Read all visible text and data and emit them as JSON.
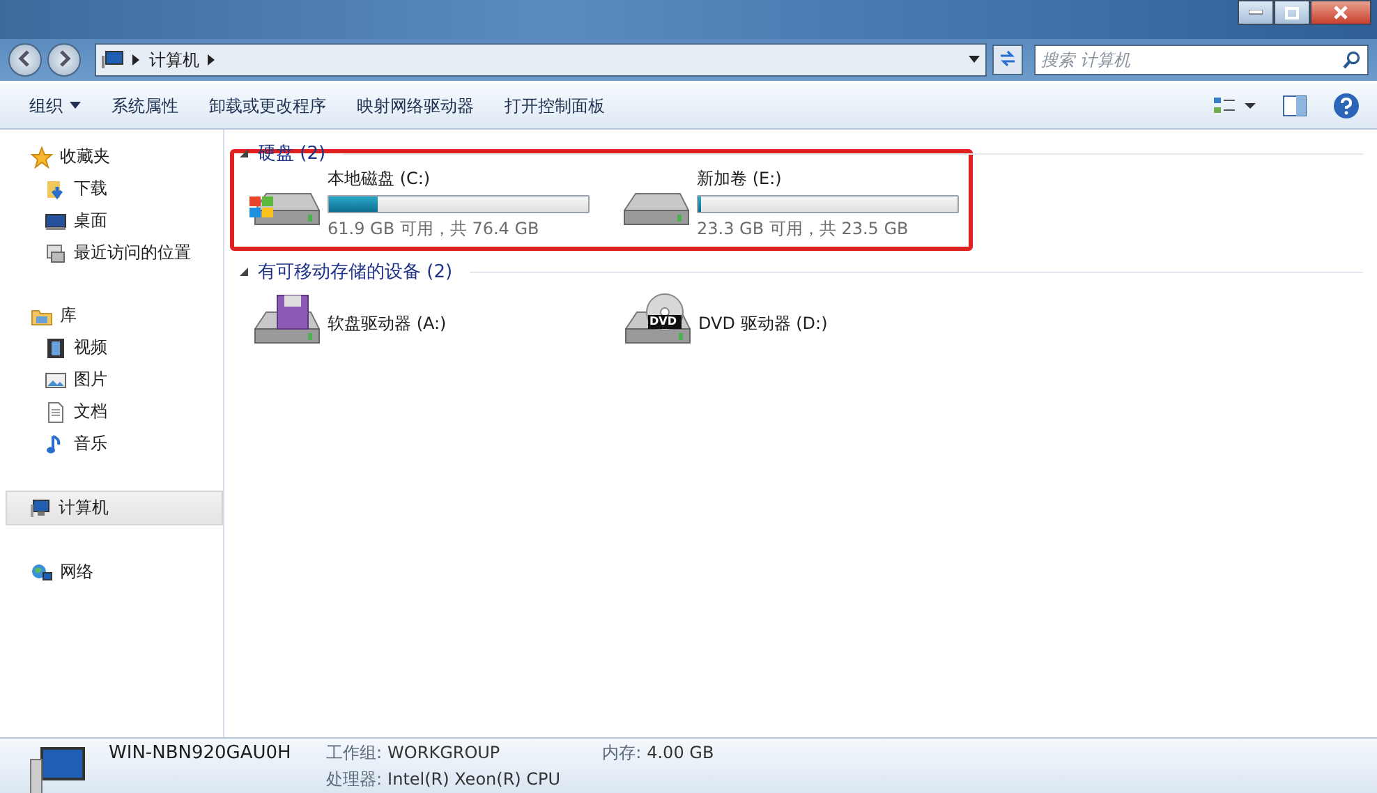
{
  "address": {
    "path": [
      "计算机"
    ]
  },
  "search": {
    "placeholder": "搜索 计算机"
  },
  "toolbar": [
    {
      "label": "组织",
      "dropdown": true
    },
    {
      "label": "系统属性",
      "dropdown": false
    },
    {
      "label": "卸载或更改程序",
      "dropdown": false
    },
    {
      "label": "映射网络驱动器",
      "dropdown": false
    },
    {
      "label": "打开控制面板",
      "dropdown": false
    }
  ],
  "sidebar": [
    {
      "label": "收藏夹",
      "selected": false,
      "children": [
        {
          "label": "下载",
          "selected": false
        },
        {
          "label": "桌面",
          "selected": false
        },
        {
          "label": "最近访问的位置",
          "selected": false
        }
      ]
    },
    {
      "label": "库",
      "selected": false,
      "children": [
        {
          "label": "视频",
          "selected": false
        },
        {
          "label": "图片",
          "selected": false
        },
        {
          "label": "文档",
          "selected": false
        },
        {
          "label": "音乐",
          "selected": false
        }
      ]
    },
    {
      "label": "计算机",
      "selected": true
    },
    {
      "label": "网络",
      "selected": false
    }
  ],
  "sections": [
    {
      "title": "硬盘 (2)",
      "expanded": true,
      "highlighted": true,
      "drives": [
        {
          "kind": "system",
          "name": "本地磁盘 (C:)",
          "level": 0.19,
          "info": "61.9 GB 可用，共 76.4 GB"
        },
        {
          "kind": "disk",
          "name": "新加卷 (E:)",
          "level": 0.01,
          "info": "23.3 GB 可用，共 23.5 GB"
        }
      ]
    },
    {
      "title": "有可移动存储的设备 (2)",
      "expanded": true,
      "highlighted": false,
      "drives": [
        {
          "kind": "floppy",
          "name": "软盘驱动器 (A:)"
        },
        {
          "kind": "dvd",
          "name": "DVD 驱动器 (D:)",
          "badge": "DVD"
        }
      ]
    }
  ],
  "details": {
    "computer_name": "WIN-NBN920GAU0H",
    "fields": [
      {
        "label": "工作组:",
        "value": "WORKGROUP"
      },
      {
        "label": "内存:",
        "value": "4.00 GB"
      },
      {
        "label": "处理器:",
        "value": "Intel(R) Xeon(R) CPU"
      }
    ]
  }
}
